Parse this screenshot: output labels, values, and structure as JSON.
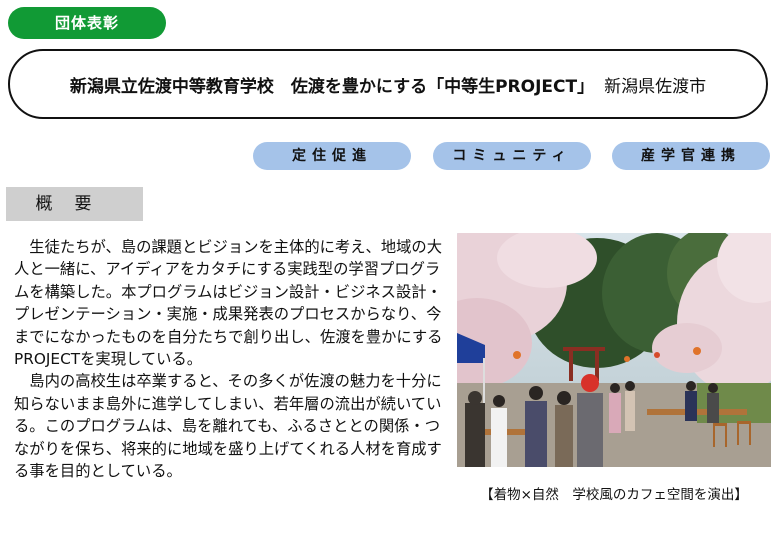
{
  "badge": {
    "label": "団体表彰"
  },
  "header": {
    "title": "新潟県立佐渡中等教育学校　佐渡を豊かにする「中等生PROJECT」",
    "location": "新潟県佐渡市"
  },
  "tags": [
    "定住促進",
    "コミュニティ",
    "産学官連携"
  ],
  "section": {
    "label": "概要"
  },
  "overview": {
    "paragraphs": [
      "生徒たちが、島の課題とビジョンを主体的に考え、地域の大人と一緒に、アイディアをカタチにする実践型の学習プログラムを構築した。本プログラムはビジョン設計・ビジネス設計・プレゼンテーション・実施・成果発表のプロセスからなり、今までになかったものを自分たちで創り出し、佐渡を豊かにするPROJECTを実現している。",
      "島内の高校生は卒業すると、その多くが佐渡の魅力を十分に知らないまま島外に進学してしまい、若年層の流出が続いている。このプログラムは、島を離れても、ふるさととの関係・つながりを保ち、将来的に地域を盛り上げてくれる人材を育成する事を目的としている。"
    ]
  },
  "photo": {
    "caption": "【着物×自然　学校風のカフェ空間を演出】"
  },
  "colors": {
    "badge": "#119a35",
    "tag": "#a5c3e9",
    "section_label": "#cfcfcf"
  }
}
